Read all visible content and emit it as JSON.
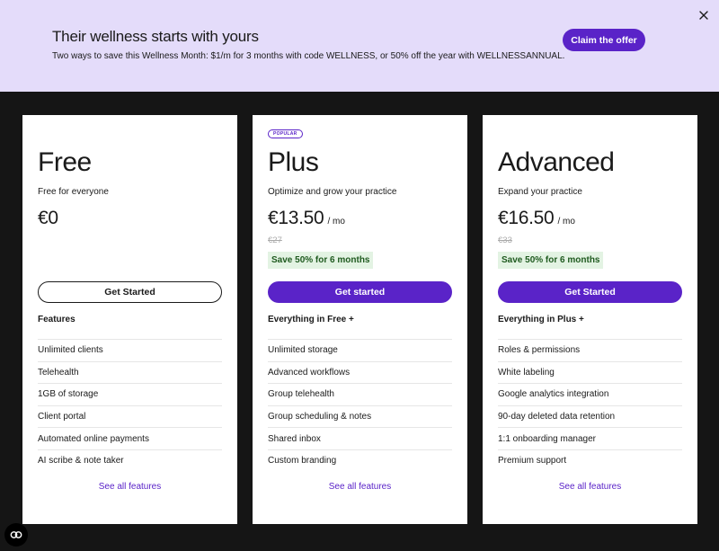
{
  "banner": {
    "title": "Their wellness starts with yours",
    "subtitle": "Two ways to save this Wellness Month: $1/m for 3 months with code WELLNESS, or 50% off the year with WELLNESSANNUAL.",
    "cta_label": "Claim the offer",
    "close_icon": "close-icon"
  },
  "plans": [
    {
      "name": "Free",
      "description": "Free for everyone",
      "price": "€0",
      "per": "",
      "old_price": "",
      "save": "",
      "cta": "Get Started",
      "features_title": "Features",
      "features": [
        "Unlimited clients",
        "Telehealth",
        "1GB of storage",
        "Client portal",
        "Automated online payments",
        "AI scribe & note taker"
      ],
      "see_all": "See all features"
    },
    {
      "badge": "POPULAR",
      "name": "Plus",
      "description": "Optimize and grow your practice",
      "price": "€13.50",
      "per": "/ mo",
      "old_price": "€27",
      "save": "Save 50% for 6 months",
      "cta": "Get started",
      "features_title": "Everything in Free +",
      "features": [
        "Unlimited storage",
        "Advanced workflows",
        "Group telehealth",
        "Group scheduling & notes",
        "Shared inbox",
        "Custom branding"
      ],
      "see_all": "See all features"
    },
    {
      "name": "Advanced",
      "description": "Expand your practice",
      "price": "€16.50",
      "per": "/ mo",
      "old_price": "€33",
      "save": "Save 50% for 6 months",
      "cta": "Get Started",
      "features_title": "Everything in Plus +",
      "features": [
        "Roles & permissions",
        "White labeling",
        "Google analytics integration",
        "90-day deleted data retention",
        "1:1 onboarding manager",
        "Premium support"
      ],
      "see_all": "See all features"
    }
  ],
  "colors": {
    "accent": "#5a23c8",
    "banner_bg": "#e4dcfa",
    "page_bg": "#151515",
    "save_bg": "#e3f3e3"
  },
  "help_icon": "help-chat-icon"
}
